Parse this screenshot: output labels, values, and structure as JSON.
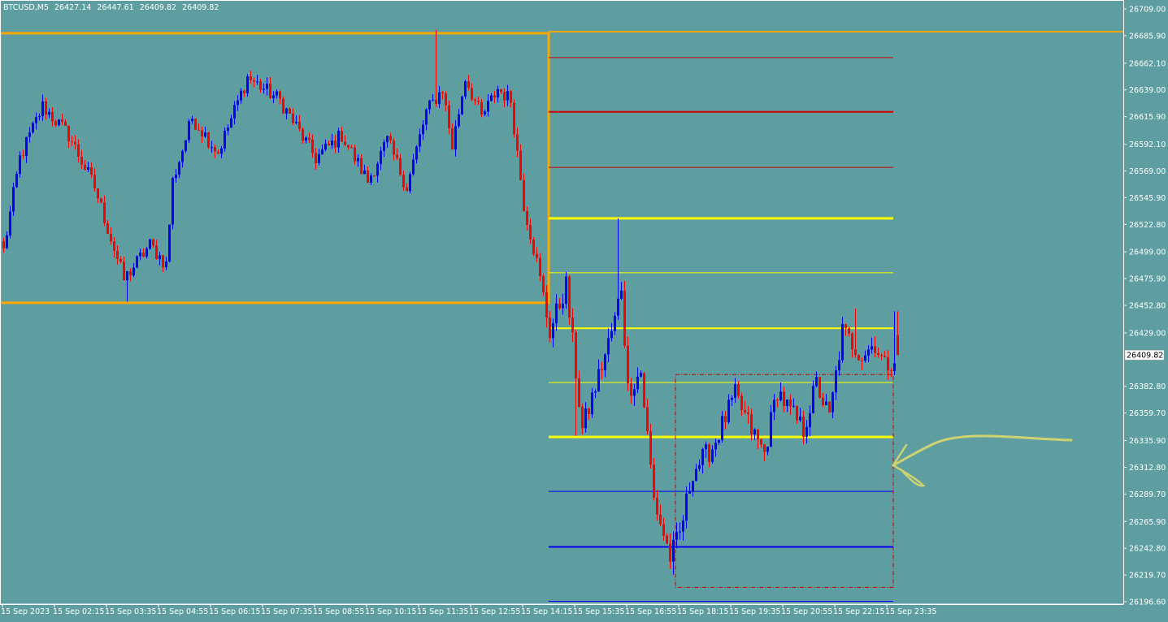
{
  "header": {
    "symbol": "BTCUSD,M5",
    "open": "26427.14",
    "high": "26447.61",
    "low": "26409.82",
    "close": "26409.82"
  },
  "colors": {
    "background": "#5f9ea0",
    "bull": "#0000ff",
    "bear": "#ff0000",
    "orange": "#ffa500",
    "yellow": "#ffff00",
    "red_level": "#cc0000",
    "blue_level": "#0000ee",
    "annotation": "#d8d86a",
    "axis_text": "#ffffff"
  },
  "current_price_label": "26409.82",
  "chart_data": {
    "type": "candlestick",
    "title": "",
    "y_tick_labels": [
      "26709.00",
      "26685.90",
      "26662.10",
      "26639.00",
      "26615.90",
      "26592.10",
      "26569.00",
      "26545.90",
      "26522.80",
      "26499.00",
      "26475.90",
      "26452.80",
      "26429.00",
      "26382.80",
      "26359.70",
      "26335.90",
      "26312.80",
      "26289.70",
      "26265.90",
      "26242.80",
      "26219.70",
      "26196.60"
    ],
    "x_tick_labels": [
      "15 Sep 2023",
      "15 Sep 02:15",
      "15 Sep 03:35",
      "15 Sep 04:55",
      "15 Sep 06:15",
      "15 Sep 07:35",
      "15 Sep 08:55",
      "15 Sep 10:15",
      "15 Sep 11:35",
      "15 Sep 12:55",
      "15 Sep 14:15",
      "15 Sep 15:35",
      "15 Sep 16:55",
      "15 Sep 18:15",
      "15 Sep 19:35",
      "15 Sep 20:55",
      "15 Sep 22:15",
      "15 Sep 23:35"
    ],
    "ylim": [
      26194.5,
      26713.9
    ],
    "bar_count": 276,
    "last_close": 26409.82,
    "price_anchors": [
      [
        0,
        26500
      ],
      [
        5,
        26580
      ],
      [
        12,
        26625
      ],
      [
        20,
        26600
      ],
      [
        28,
        26555
      ],
      [
        37,
        26475
      ],
      [
        45,
        26505
      ],
      [
        50,
        26488
      ],
      [
        52,
        26560
      ],
      [
        58,
        26615
      ],
      [
        66,
        26585
      ],
      [
        75,
        26650
      ],
      [
        85,
        26630
      ],
      [
        96,
        26580
      ],
      [
        104,
        26600
      ],
      [
        112,
        26560
      ],
      [
        118,
        26595
      ],
      [
        124,
        26555
      ],
      [
        130,
        26620
      ],
      [
        135,
        26640
      ],
      [
        138,
        26590
      ],
      [
        142,
        26650
      ],
      [
        147,
        26615
      ],
      [
        152,
        26640
      ],
      [
        156,
        26630
      ],
      [
        160,
        26540
      ],
      [
        164,
        26490
      ],
      [
        168,
        26430
      ],
      [
        173,
        26470
      ],
      [
        178,
        26345
      ],
      [
        185,
        26410
      ],
      [
        188,
        26440
      ],
      [
        190,
        26470
      ],
      [
        192,
        26380
      ],
      [
        196,
        26395
      ],
      [
        200,
        26285
      ],
      [
        205,
        26235
      ],
      [
        208,
        26255
      ],
      [
        212,
        26310
      ],
      [
        218,
        26330
      ],
      [
        225,
        26375
      ],
      [
        230,
        26345
      ],
      [
        234,
        26325
      ],
      [
        238,
        26380
      ],
      [
        241,
        26365
      ],
      [
        246,
        26345
      ],
      [
        250,
        26385
      ],
      [
        254,
        26355
      ],
      [
        258,
        26430
      ],
      [
        264,
        26410
      ],
      [
        268,
        26420
      ],
      [
        271,
        26400
      ],
      [
        275,
        26410
      ]
    ],
    "highs": [
      {
        "bar": 133,
        "price": 26691.0
      },
      {
        "bar": 189,
        "price": 26528.0
      },
      {
        "bar": 262,
        "price": 26450.0
      },
      {
        "bar": 274,
        "price": 26447.61
      }
    ],
    "lows": [
      {
        "bar": 38,
        "price": 26456.0
      },
      {
        "bar": 176,
        "price": 26340.0
      },
      {
        "bar": 206,
        "price": 26220.0
      }
    ],
    "zone": {
      "top": 26688.0,
      "bottom": 26455.0,
      "start_bar": 0,
      "end_bar": 168,
      "label": ""
    },
    "range_box": {
      "top": 26393.0,
      "bottom": 26209.0,
      "start_bar": 207,
      "end_bar": 274
    },
    "top_line": 26689.3,
    "levels": [
      {
        "price": 26667.0,
        "color": "red",
        "width": 1
      },
      {
        "price": 26620.0,
        "color": "red",
        "width": 2
      },
      {
        "price": 26572.0,
        "color": "red",
        "width": 1
      },
      {
        "price": 26528.0,
        "color": "yellow",
        "width": 3
      },
      {
        "price": 26481.0,
        "color": "yellow",
        "width": 1
      },
      {
        "price": 26433.0,
        "color": "yellow",
        "width": 2
      },
      {
        "price": 26386.0,
        "color": "yellow",
        "width": 1
      },
      {
        "price": 26339.0,
        "color": "yellow",
        "width": 3
      },
      {
        "price": 26292.0,
        "color": "blue",
        "width": 1
      },
      {
        "price": 26244.0,
        "color": "blue",
        "width": 2
      },
      {
        "price": 26197.0,
        "color": "blue",
        "width": 1
      }
    ],
    "levels_start_bar": 168,
    "levels_end_bar": 274
  }
}
